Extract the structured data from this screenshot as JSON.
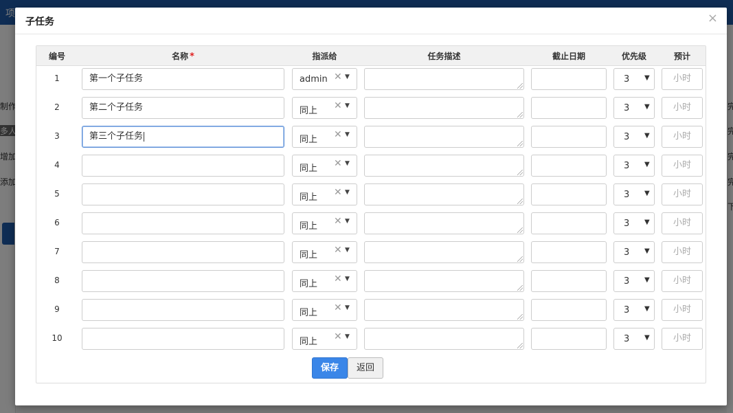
{
  "background": {
    "top_left_text": "项",
    "side_items": [
      "制作",
      "多人",
      "增加",
      "添加"
    ],
    "right_items": [
      "完",
      "完",
      "完",
      "完",
      "下"
    ]
  },
  "modal": {
    "title": "子任务",
    "close_symbol": "×"
  },
  "table": {
    "headers": {
      "num": "编号",
      "name": "名称",
      "required_mark": "*",
      "assign": "指派给",
      "desc": "任务描述",
      "deadline": "截止日期",
      "priority": "优先级",
      "estimate": "预计"
    },
    "estimate_placeholder": "小时",
    "rows": [
      {
        "num": "1",
        "name": "第一个子任务",
        "assign": "admin",
        "priority": "3"
      },
      {
        "num": "2",
        "name": "第二个子任务",
        "assign": "同上",
        "priority": "3"
      },
      {
        "num": "3",
        "name": "第三个子任务",
        "assign": "同上",
        "priority": "3",
        "focused": true
      },
      {
        "num": "4",
        "name": "",
        "assign": "同上",
        "priority": "3"
      },
      {
        "num": "5",
        "name": "",
        "assign": "同上",
        "priority": "3"
      },
      {
        "num": "6",
        "name": "",
        "assign": "同上",
        "priority": "3"
      },
      {
        "num": "7",
        "name": "",
        "assign": "同上",
        "priority": "3"
      },
      {
        "num": "8",
        "name": "",
        "assign": "同上",
        "priority": "3"
      },
      {
        "num": "9",
        "name": "",
        "assign": "同上",
        "priority": "3"
      },
      {
        "num": "10",
        "name": "",
        "assign": "同上",
        "priority": "3"
      }
    ]
  },
  "buttons": {
    "save": "保存",
    "back": "返回"
  },
  "colors": {
    "primary": "#3a86e8",
    "required": "#e02020",
    "topbar": "#1e5aa8"
  }
}
